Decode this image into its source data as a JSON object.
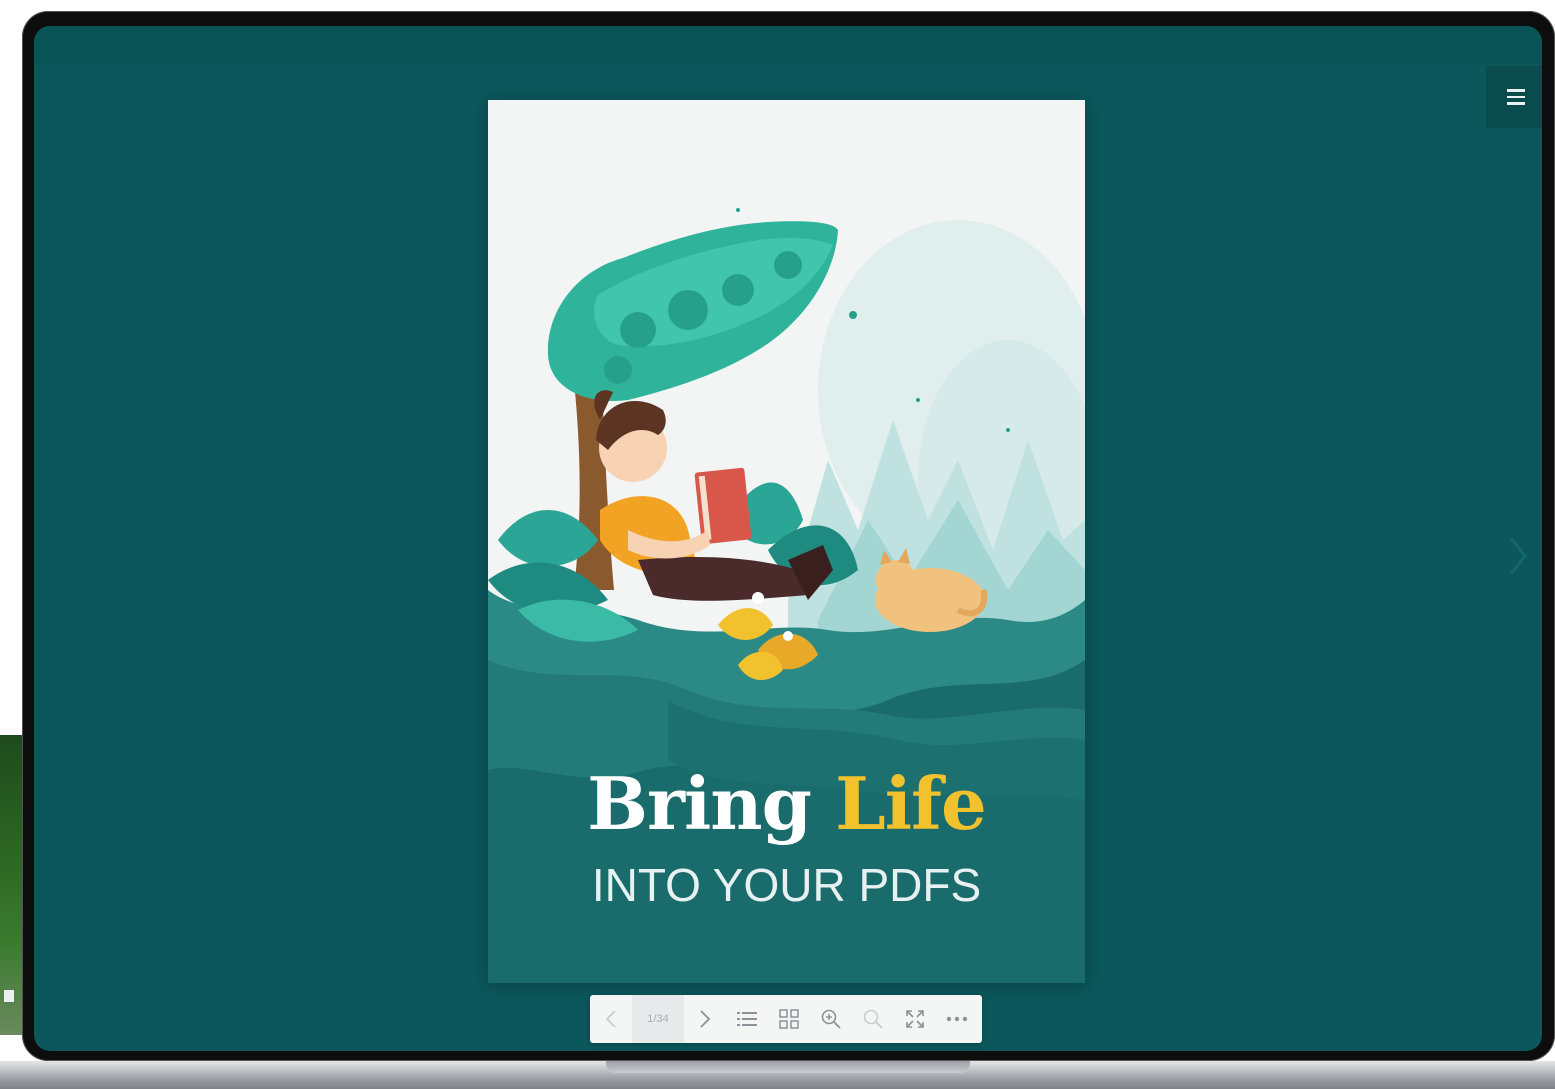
{
  "viewer": {
    "menu_icon": "hamburger-menu-icon",
    "next_icon": "chevron-right-icon",
    "background_color": "#0b575b"
  },
  "cover": {
    "title_word1": "Bring",
    "title_word2": "Life",
    "subtitle": "INTO YOUR PDFS",
    "title_color": "#ffffff",
    "accent_color": "#f2c12e",
    "page_color": "#196b6c"
  },
  "toolbar": {
    "page_indicator": "1/34",
    "buttons": [
      {
        "name": "previous-page",
        "icon": "chevron-left-icon"
      },
      {
        "name": "next-page",
        "icon": "chevron-right-icon"
      },
      {
        "name": "table-of-contents",
        "icon": "list-icon"
      },
      {
        "name": "thumbnails",
        "icon": "grid-icon"
      },
      {
        "name": "zoom-in",
        "icon": "zoom-in-icon"
      },
      {
        "name": "zoom-out",
        "icon": "zoom-out-icon"
      },
      {
        "name": "fullscreen",
        "icon": "fullscreen-icon"
      },
      {
        "name": "more",
        "icon": "more-icon"
      }
    ]
  }
}
